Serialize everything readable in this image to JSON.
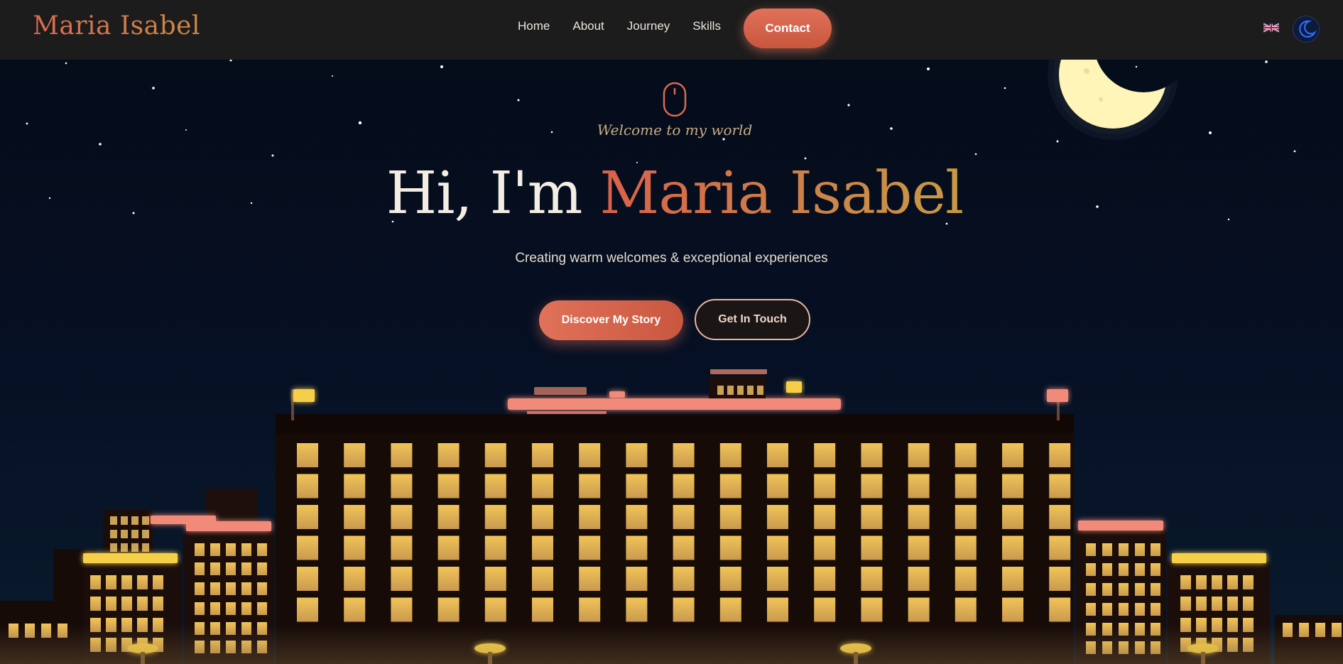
{
  "nav": {
    "brand": "Maria Isabel",
    "links": [
      "Home",
      "About",
      "Journey",
      "Skills"
    ],
    "contact_label": "Contact",
    "language_icon": "uk-flag-icon",
    "theme_icon": "moon-icon"
  },
  "hero": {
    "welcome": "Welcome to my world",
    "title_prefix": "Hi, I'm ",
    "title_name": "Maria Isabel",
    "subtitle": "Creating warm welcomes & exceptional experiences",
    "primary_cta": "Discover My Story",
    "secondary_cta": "Get In Touch"
  },
  "colors": {
    "accent": "#e07259",
    "gold": "#c9953f",
    "window": "#e8b84e",
    "building": "#170b08",
    "sky": "#061024"
  }
}
